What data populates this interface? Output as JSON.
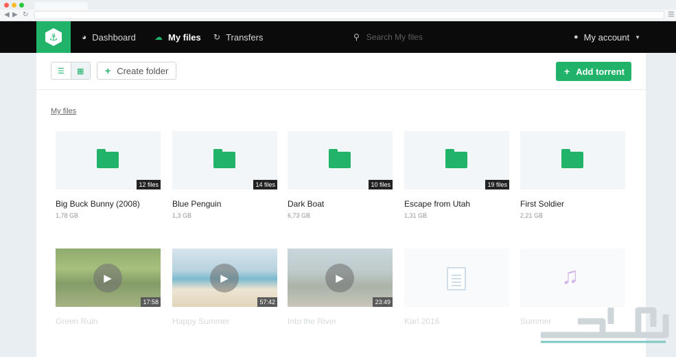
{
  "nav": {
    "logo_icon": "anchor-icon",
    "items": [
      {
        "label": "Dashboard",
        "icon": "gauge-icon"
      },
      {
        "label": "My files",
        "icon": "cloud-icon"
      },
      {
        "label": "Transfers",
        "icon": "refresh-icon"
      }
    ],
    "search_placeholder": "Search My files",
    "account_label": "My account"
  },
  "toolbar": {
    "create_folder_label": "Create folder",
    "add_torrent_label": "Add torrent"
  },
  "breadcrumb": "My files",
  "folders": [
    {
      "name": "Big Buck Bunny (2008)",
      "size": "1,78 GB",
      "files": "12 files"
    },
    {
      "name": "Blue Penguin",
      "size": "1,3 GB",
      "files": "14 files"
    },
    {
      "name": "Dark Boat",
      "size": "6,73 GB",
      "files": "10 files"
    },
    {
      "name": "Escape from Utah",
      "size": "1,31 GB",
      "files": "19 files"
    },
    {
      "name": "First Soldier",
      "size": "2,21 GB"
    }
  ],
  "media": [
    {
      "name": "Green Ruin",
      "duration": "17:58",
      "type": "video"
    },
    {
      "name": "Happy Summer",
      "duration": "57:42",
      "type": "video"
    },
    {
      "name": "Into the River",
      "duration": "23:49",
      "type": "video"
    },
    {
      "name": "Karl 2016",
      "type": "document"
    },
    {
      "name": "Summer",
      "type": "audio"
    }
  ],
  "colors": {
    "accent": "#21b36a",
    "header_bg": "#0b0b0b"
  }
}
